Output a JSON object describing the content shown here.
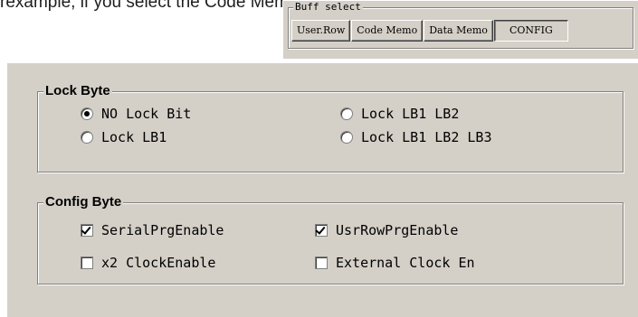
{
  "background_text": "rexample, if you select the Code Memo, the Code M",
  "buff_select": {
    "legend": "Buff select",
    "tabs": [
      "User.Row",
      "Code Memo",
      "Data Memo",
      "CONFIG"
    ],
    "active_tab": "CONFIG"
  },
  "lock_byte": {
    "title": "Lock Byte",
    "options": [
      {
        "label": "NO Lock Bit",
        "selected": true
      },
      {
        "label": "Lock LB1 LB2",
        "selected": false
      },
      {
        "label": "Lock LB1",
        "selected": false
      },
      {
        "label": "Lock LB1 LB2 LB3",
        "selected": false
      }
    ]
  },
  "config_byte": {
    "title": "Config Byte",
    "options": [
      {
        "label": "SerialPrgEnable",
        "checked": true
      },
      {
        "label": "UsrRowPrgEnable",
        "checked": true
      },
      {
        "label": "x2 ClockEnable",
        "checked": false
      },
      {
        "label": "External Clock En",
        "checked": false
      }
    ]
  }
}
